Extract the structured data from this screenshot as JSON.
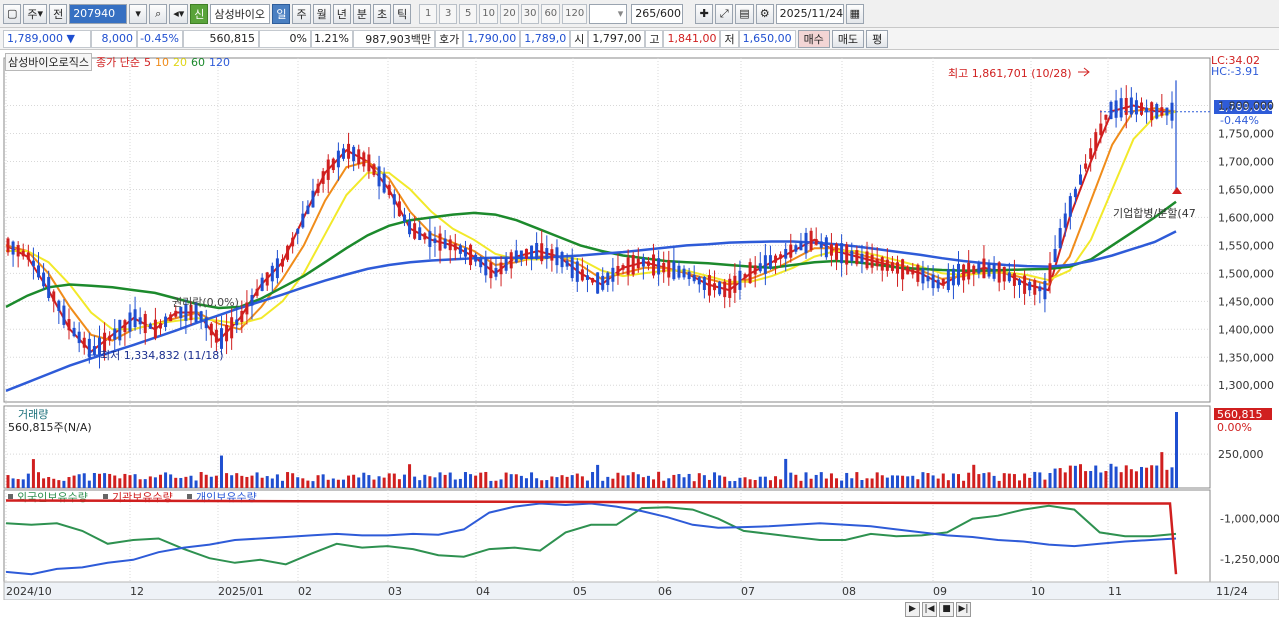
{
  "toolbar": {
    "period_unit": "주",
    "prev_label": "전",
    "code": "207940",
    "stock_badge": "신",
    "stock_name": "삼성바이오",
    "intervals": [
      "일",
      "주",
      "월",
      "년",
      "분",
      "초",
      "틱"
    ],
    "active_interval": "일",
    "tick_steps": [
      "1",
      "3",
      "5",
      "10",
      "20",
      "30",
      "60",
      "120"
    ],
    "count": "265",
    "count_total": "/600",
    "date": "2025/11/24"
  },
  "quote": {
    "price": "1,789,000",
    "change": "8,000",
    "change_pct": "-0.45%",
    "volume": "560,815",
    "vol_ratio": "0%",
    "turnover_pct": "1.21%",
    "amount": "987,903백만",
    "bid_label": "호가",
    "ask": "1,790,00",
    "bid": "1,789,0",
    "open_label": "시",
    "open": "1,797,00",
    "high_label": "고",
    "high": "1,841,00",
    "low_label": "저",
    "low": "1,650,00",
    "buy_label": "매수",
    "sell_label": "매도",
    "flat_label": "평"
  },
  "legend": {
    "name": "삼성바이오로직스",
    "ma_label": "종가 단순",
    "ma_periods": [
      "5",
      "10",
      "20",
      "60",
      "120"
    ]
  },
  "colors": {
    "up": "#d01f1f",
    "down": "#1f4fd0",
    "ma5": "#d01f1f",
    "ma10": "#f08c1a",
    "ma20": "#f2e92a",
    "ma60": "#1c8a2c",
    "ma120": "#2e5bd8",
    "foreign": "#2e9150",
    "institution": "#d01f1f",
    "individual": "#2e5bd8"
  },
  "chart_data": [
    {
      "type": "line",
      "panel": "price",
      "title": "",
      "y_ticks": [
        "1,800,000",
        "1,750,000",
        "1,700,000",
        "1,650,000",
        "1,600,000",
        "1,550,000",
        "1,500,000",
        "1,450,000",
        "1,400,000",
        "1,350,000",
        "1,300,000"
      ],
      "ylim": [
        1270000,
        1885000
      ],
      "x_ticks": [
        "2024/10",
        "12",
        "2025/01",
        "02",
        "03",
        "04",
        "05",
        "06",
        "07",
        "08",
        "09",
        "10",
        "11",
        "11/24"
      ],
      "current_price_label": "1,789,000",
      "current_change_label": "-0.44%",
      "lc_label": "LC:34.02",
      "hc_label": "HC:-3.91",
      "max_annotation": "최고 1,861,701 (10/28)",
      "min_annotation": "최저 1,334,832 (11/18)",
      "event_annotation_1": "권리락(0.0%)",
      "event_annotation_2": "기업합병/분할(47",
      "series": [
        {
          "name": "5",
          "values": [
            1550000,
            1530000,
            1470000,
            1400000,
            1360000,
            1390000,
            1420000,
            1400000,
            1430000,
            1430000,
            1380000,
            1420000,
            1480000,
            1520000,
            1600000,
            1680000,
            1720000,
            1700000,
            1650000,
            1580000,
            1560000,
            1550000,
            1530000,
            1500000,
            1530000,
            1540000,
            1530000,
            1500000,
            1480000,
            1510000,
            1520000,
            1510000,
            1500000,
            1480000,
            1470000,
            1500000,
            1520000,
            1540000,
            1560000,
            1540000,
            1530000,
            1520000,
            1510000,
            1500000,
            1480000,
            1500000,
            1510000,
            1500000,
            1480000,
            1470000,
            1600000,
            1700000,
            1790000,
            1800000,
            1790000,
            1789000
          ]
        },
        {
          "name": "10",
          "values": [
            1550000,
            1540000,
            1500000,
            1440000,
            1390000,
            1380000,
            1400000,
            1410000,
            1420000,
            1430000,
            1410000,
            1400000,
            1440000,
            1490000,
            1550000,
            1630000,
            1690000,
            1700000,
            1670000,
            1610000,
            1570000,
            1555000,
            1540000,
            1515000,
            1520000,
            1530000,
            1530000,
            1515000,
            1490000,
            1500000,
            1510000,
            1510000,
            1500000,
            1490000,
            1480000,
            1490000,
            1505000,
            1525000,
            1545000,
            1545000,
            1535000,
            1525000,
            1515000,
            1505000,
            1490000,
            1495000,
            1505000,
            1500000,
            1490000,
            1480000,
            1530000,
            1630000,
            1730000,
            1790000,
            1795000,
            1789000
          ]
        },
        {
          "name": "20",
          "values": [
            1540000,
            1540000,
            1520000,
            1480000,
            1430000,
            1400000,
            1400000,
            1410000,
            1415000,
            1420000,
            1415000,
            1410000,
            1420000,
            1450000,
            1500000,
            1570000,
            1640000,
            1680000,
            1680000,
            1650000,
            1610000,
            1580000,
            1560000,
            1535000,
            1525000,
            1525000,
            1530000,
            1525000,
            1505000,
            1495000,
            1500000,
            1505000,
            1505000,
            1495000,
            1485000,
            1485000,
            1495000,
            1510000,
            1530000,
            1540000,
            1540000,
            1532000,
            1522000,
            1512000,
            1500000,
            1497000,
            1500000,
            1502000,
            1497000,
            1488000,
            1505000,
            1560000,
            1650000,
            1740000,
            1780000,
            1789000
          ]
        },
        {
          "name": "60",
          "values": [
            1440000,
            1460000,
            1475000,
            1480000,
            1478000,
            1475000,
            1470000,
            1465000,
            1455000,
            1445000,
            1438000,
            1440000,
            1455000,
            1475000,
            1495000,
            1520000,
            1545000,
            1568000,
            1585000,
            1595000,
            1600000,
            1605000,
            1608000,
            1605000,
            1595000,
            1580000,
            1565000,
            1550000,
            1540000,
            1532000,
            1527000,
            1522000,
            1520000,
            1518000,
            1515000,
            1512000,
            1510000,
            1515000,
            1520000,
            1522000,
            1520000,
            1515000,
            1510000,
            1508000,
            1506000,
            1505000,
            1505000,
            1506000,
            1507000,
            1508000,
            1512000,
            1525000,
            1550000,
            1575000,
            1600000,
            1628000
          ]
        },
        {
          "name": "120",
          "values": [
            1290000,
            1305000,
            1320000,
            1335000,
            1348000,
            1360000,
            1372000,
            1385000,
            1398000,
            1412000,
            1425000,
            1438000,
            1450000,
            1462000,
            1475000,
            1487000,
            1498000,
            1508000,
            1515000,
            1520000,
            1523000,
            1525000,
            1527000,
            1528000,
            1528000,
            1528000,
            1530000,
            1532000,
            1535000,
            1538000,
            1542000,
            1546000,
            1550000,
            1552000,
            1555000,
            1556000,
            1557000,
            1557000,
            1555000,
            1552000,
            1548000,
            1543000,
            1538000,
            1533000,
            1527000,
            1522000,
            1518000,
            1515000,
            1513000,
            1512000,
            1515000,
            1522000,
            1532000,
            1544000,
            1556000,
            1575000
          ]
        }
      ]
    },
    {
      "type": "bar",
      "panel": "volume",
      "title": "거래량",
      "volume_label": "560,815주(N/A)",
      "current_label": "560,815",
      "current_pct_label": "0.00%",
      "y_ticks": [
        "250,000"
      ],
      "ylim": [
        0,
        560815
      ]
    },
    {
      "type": "line",
      "panel": "ownership",
      "series_names": [
        "외국인보유수량",
        "기관보유수량",
        "개인보유수량"
      ],
      "y_ticks": [
        "-1,000,000",
        "-1,250,000"
      ]
    }
  ],
  "bottom_toolbar": [
    "▶",
    "|◀",
    "■",
    "▶|"
  ]
}
